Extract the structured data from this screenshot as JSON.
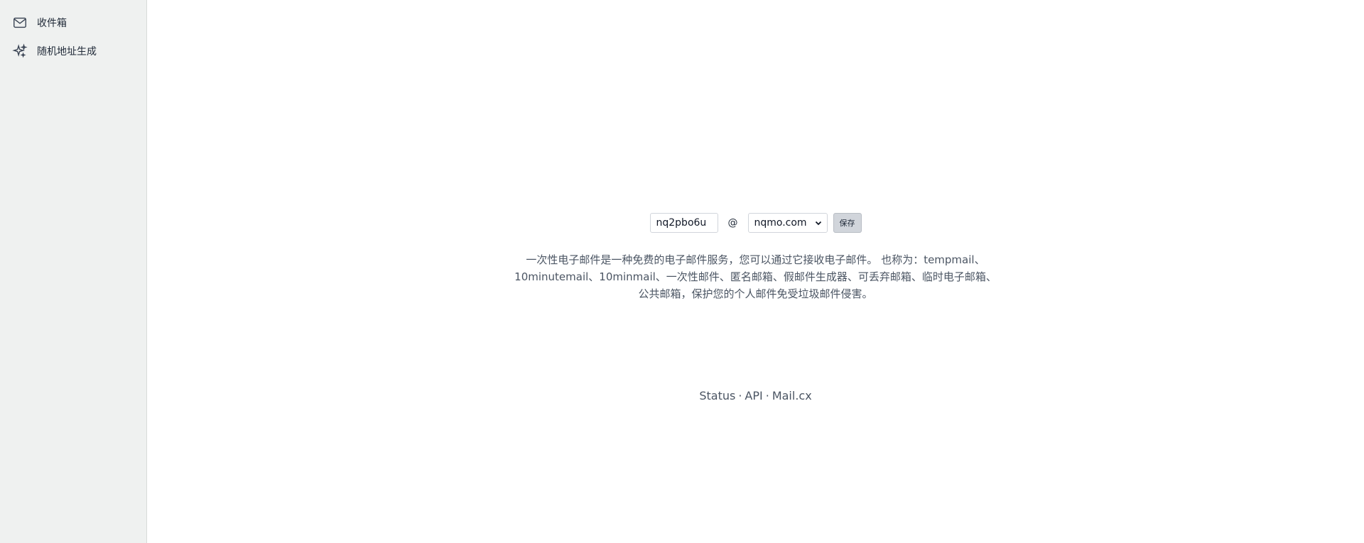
{
  "sidebar": {
    "items": [
      {
        "label": "收件箱",
        "icon": "mail-icon"
      },
      {
        "label": "随机地址生成",
        "icon": "sparkles-icon"
      }
    ]
  },
  "address": {
    "local_part": "nq2pbo6u",
    "at": "@",
    "domain": "nqmo.com",
    "save_label": "保存"
  },
  "description": "一次性电子邮件是一种免费的电子邮件服务，您可以通过它接收电子邮件。 也称为：tempmail、10minutemail、10minmail、一次性邮件、匿名邮箱、假邮件生成器、可丢弃邮箱、临时电子邮箱、公共邮箱，保护您的个人邮件免受垃圾邮件侵害。",
  "footer": {
    "links": [
      "Status",
      "API",
      "Mail.cx"
    ],
    "separator": "·"
  }
}
